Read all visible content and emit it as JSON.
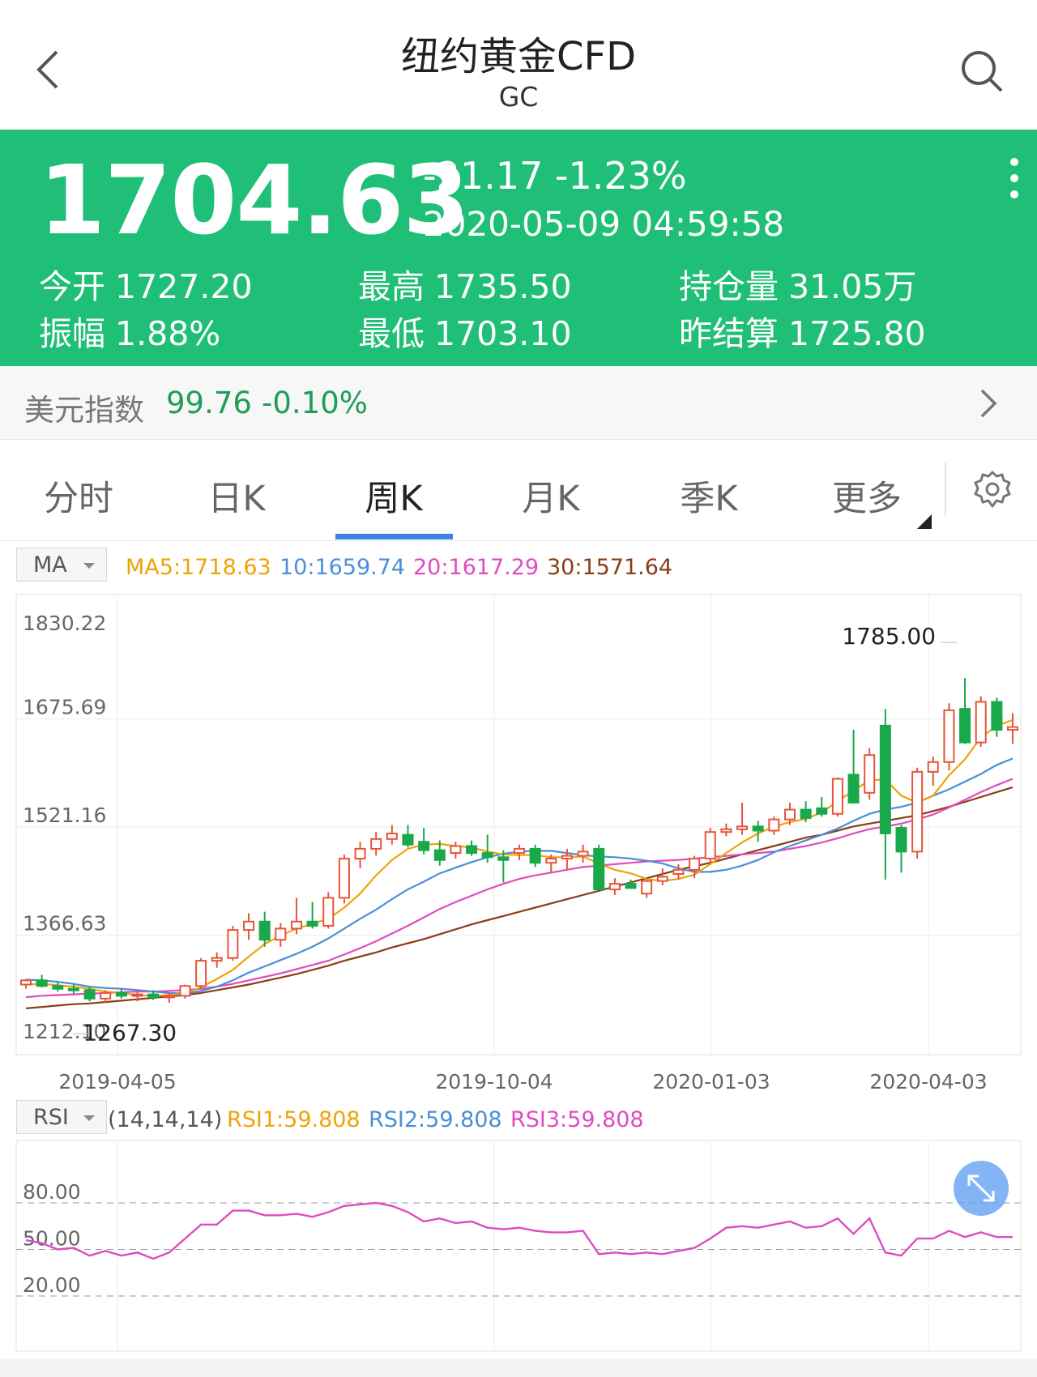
{
  "header": {
    "title": "纽约黄金CFD",
    "subtitle": "GC",
    "back_icon": "chevron-left-icon",
    "search_icon": "search-icon"
  },
  "colors": {
    "accent": "#20bf78",
    "up": "#e8543a",
    "down": "#19a84a",
    "ma5": "#f0a20a",
    "ma10": "#4a8fd8",
    "ma20": "#e04bbf",
    "ma30": "#8a3e16",
    "tab_active": "#3b82e6"
  },
  "quote": {
    "price": "1704.63",
    "change": "-21.17  -1.23%",
    "time": "2020-05-09  04:59:58",
    "stats": [
      {
        "label": "今开",
        "value": "1727.20"
      },
      {
        "label": "最高",
        "value": "1735.50"
      },
      {
        "label": "持仓量",
        "value": "31.05万"
      },
      {
        "label": "振幅",
        "value": "1.88%"
      },
      {
        "label": "最低",
        "value": "1703.10"
      },
      {
        "label": "昨结算",
        "value": "1725.80"
      }
    ]
  },
  "dollar_index": {
    "label": "美元指数",
    "value": "99.76",
    "change": "-0.10%"
  },
  "tabs": [
    {
      "label": "分时",
      "active": false
    },
    {
      "label": "日K",
      "active": false
    },
    {
      "label": "周K",
      "active": true
    },
    {
      "label": "月K",
      "active": false
    },
    {
      "label": "季K",
      "active": false
    },
    {
      "label": "更多",
      "active": false
    }
  ],
  "indicators": {
    "ma_selector": "MA",
    "ma5": "MA5:1718.63",
    "ma10": "10:1659.74",
    "ma20": "20:1617.29",
    "ma30": "30:1571.64",
    "rsi_selector": "RSI",
    "rsi_params": "(14,14,14)",
    "rsi1": "RSI1:59.808",
    "rsi2": "RSI2:59.808",
    "rsi3": "RSI3:59.808"
  },
  "chart_data": [
    {
      "type": "candlestick",
      "y_ticks": [
        "1830.22",
        "1675.69",
        "1521.16",
        "1366.63",
        "1212.10"
      ],
      "ylim": [
        1212.1,
        1830.22
      ],
      "x_ticks": [
        "2019-04-05",
        "2019-10-04",
        "2020-01-03",
        "2020-04-03"
      ],
      "max_annotation": "1785.00",
      "min_annotation": "1267.30",
      "candles": [
        [
          1296,
          1304,
          1290,
          1302
        ],
        [
          1302,
          1310,
          1292,
          1294
        ],
        [
          1294,
          1300,
          1286,
          1290
        ],
        [
          1290,
          1296,
          1282,
          1288
        ],
        [
          1288,
          1292,
          1272,
          1276
        ],
        [
          1276,
          1288,
          1270,
          1284
        ],
        [
          1284,
          1290,
          1276,
          1280
        ],
        [
          1280,
          1286,
          1272,
          1282
        ],
        [
          1282,
          1288,
          1274,
          1278
        ],
        [
          1278,
          1284,
          1270,
          1280
        ],
        [
          1280,
          1296,
          1276,
          1294
        ],
        [
          1294,
          1334,
          1290,
          1330
        ],
        [
          1330,
          1342,
          1320,
          1334
        ],
        [
          1334,
          1380,
          1330,
          1374
        ],
        [
          1374,
          1398,
          1360,
          1386
        ],
        [
          1386,
          1400,
          1350,
          1360
        ],
        [
          1360,
          1384,
          1350,
          1376
        ],
        [
          1376,
          1420,
          1368,
          1386
        ],
        [
          1386,
          1414,
          1376,
          1380
        ],
        [
          1380,
          1428,
          1376,
          1420
        ],
        [
          1420,
          1482,
          1412,
          1476
        ],
        [
          1476,
          1500,
          1462,
          1490
        ],
        [
          1490,
          1514,
          1480,
          1504
        ],
        [
          1504,
          1524,
          1496,
          1512
        ],
        [
          1510,
          1524,
          1492,
          1496
        ],
        [
          1500,
          1520,
          1482,
          1488
        ],
        [
          1488,
          1502,
          1466,
          1474
        ],
        [
          1484,
          1500,
          1476,
          1494
        ],
        [
          1494,
          1502,
          1480,
          1484
        ],
        [
          1484,
          1510,
          1470,
          1478
        ],
        [
          1478,
          1488,
          1442,
          1474
        ],
        [
          1484,
          1496,
          1474,
          1490
        ],
        [
          1490,
          1496,
          1464,
          1470
        ],
        [
          1470,
          1482,
          1456,
          1476
        ],
        [
          1476,
          1490,
          1460,
          1480
        ],
        [
          1480,
          1496,
          1470,
          1486
        ],
        [
          1490,
          1496,
          1432,
          1432
        ],
        [
          1432,
          1448,
          1424,
          1440
        ],
        [
          1440,
          1446,
          1434,
          1434
        ],
        [
          1426,
          1448,
          1420,
          1444
        ],
        [
          1444,
          1462,
          1438,
          1450
        ],
        [
          1454,
          1468,
          1446,
          1460
        ],
        [
          1460,
          1480,
          1448,
          1476
        ],
        [
          1476,
          1520,
          1470,
          1514
        ],
        [
          1514,
          1526,
          1508,
          1518
        ],
        [
          1518,
          1556,
          1510,
          1522
        ],
        [
          1522,
          1530,
          1500,
          1516
        ],
        [
          1516,
          1536,
          1510,
          1532
        ],
        [
          1532,
          1556,
          1524,
          1546
        ],
        [
          1546,
          1558,
          1528,
          1534
        ],
        [
          1548,
          1564,
          1536,
          1540
        ],
        [
          1540,
          1592,
          1536,
          1590
        ],
        [
          1596,
          1660,
          1560,
          1556
        ],
        [
          1570,
          1634,
          1560,
          1624
        ],
        [
          1666,
          1690,
          1446,
          1512
        ],
        [
          1520,
          1524,
          1456,
          1486
        ],
        [
          1486,
          1606,
          1476,
          1600
        ],
        [
          1600,
          1622,
          1580,
          1614
        ],
        [
          1614,
          1698,
          1602,
          1688
        ],
        [
          1690,
          1734,
          1640,
          1642
        ],
        [
          1642,
          1708,
          1636,
          1700
        ],
        [
          1700,
          1706,
          1650,
          1660
        ],
        [
          1660,
          1684,
          1640,
          1664
        ]
      ],
      "ma5": [
        1296,
        1297,
        1295,
        1293,
        1290,
        1286,
        1284,
        1281,
        1280,
        1281,
        1283,
        1292,
        1304,
        1317,
        1336,
        1354,
        1366,
        1376,
        1383,
        1390,
        1406,
        1426,
        1452,
        1474,
        1490,
        1496,
        1497,
        1494,
        1492,
        1486,
        1482,
        1481,
        1481,
        1478,
        1478,
        1479,
        1469,
        1460,
        1455,
        1447,
        1444,
        1447,
        1453,
        1468,
        1484,
        1499,
        1512,
        1522,
        1528,
        1533,
        1542,
        1558,
        1573,
        1588,
        1589,
        1566,
        1556,
        1566,
        1595,
        1618,
        1649,
        1666,
        1674
      ],
      "ma10": [
        1303,
        1302,
        1300,
        1297,
        1293,
        1291,
        1290,
        1288,
        1286,
        1284,
        1283,
        1287,
        1293,
        1302,
        1313,
        1322,
        1331,
        1340,
        1350,
        1362,
        1376,
        1390,
        1403,
        1418,
        1432,
        1443,
        1455,
        1463,
        1471,
        1478,
        1483,
        1486,
        1487,
        1487,
        1484,
        1481,
        1479,
        1478,
        1476,
        1473,
        1469,
        1462,
        1457,
        1457,
        1460,
        1466,
        1474,
        1485,
        1494,
        1502,
        1510,
        1519,
        1530,
        1540,
        1546,
        1550,
        1556,
        1566,
        1575,
        1586,
        1597,
        1610,
        1619
      ],
      "ma20": [
        1278,
        1280,
        1281,
        1282,
        1283,
        1284,
        1285,
        1286,
        1286,
        1287,
        1288,
        1290,
        1293,
        1297,
        1302,
        1307,
        1312,
        1318,
        1324,
        1330,
        1339,
        1348,
        1358,
        1369,
        1380,
        1392,
        1404,
        1414,
        1423,
        1432,
        1440,
        1447,
        1452,
        1456,
        1460,
        1464,
        1466,
        1468,
        1470,
        1472,
        1473,
        1474,
        1476,
        1478,
        1480,
        1482,
        1484,
        1486,
        1490,
        1494,
        1499,
        1505,
        1512,
        1518,
        1522,
        1526,
        1532,
        1539,
        1549,
        1560,
        1571,
        1581,
        1590
      ],
      "ma30": [
        1262,
        1264,
        1266,
        1268,
        1269,
        1271,
        1273,
        1275,
        1277,
        1279,
        1281,
        1284,
        1288,
        1292,
        1296,
        1301,
        1306,
        1311,
        1317,
        1323,
        1330,
        1336,
        1342,
        1349,
        1355,
        1361,
        1368,
        1375,
        1382,
        1388,
        1394,
        1400,
        1406,
        1412,
        1418,
        1424,
        1430,
        1436,
        1442,
        1448,
        1454,
        1460,
        1465,
        1470,
        1476,
        1482,
        1488,
        1494,
        1500,
        1506,
        1510,
        1516,
        1522,
        1526,
        1530,
        1534,
        1538,
        1544,
        1550,
        1557,
        1564,
        1571,
        1578
      ]
    },
    {
      "type": "line",
      "series_name": "RSI",
      "y_ticks": [
        "80.00",
        "50.00",
        "20.00"
      ],
      "reference_lines": [
        80,
        50,
        20
      ],
      "values": [
        56,
        54,
        50,
        51,
        46,
        49,
        46,
        48,
        44,
        48,
        57,
        66,
        66,
        75,
        75,
        72,
        72,
        73,
        71,
        74,
        78,
        79,
        80,
        78,
        74,
        68,
        70,
        67,
        68,
        64,
        63,
        64,
        62,
        61,
        61,
        62,
        47,
        48,
        47,
        48,
        47,
        49,
        51,
        57,
        64,
        65,
        64,
        66,
        68,
        64,
        65,
        70,
        60,
        70,
        48,
        46,
        57,
        57,
        62,
        58,
        61,
        58,
        58
      ]
    }
  ]
}
